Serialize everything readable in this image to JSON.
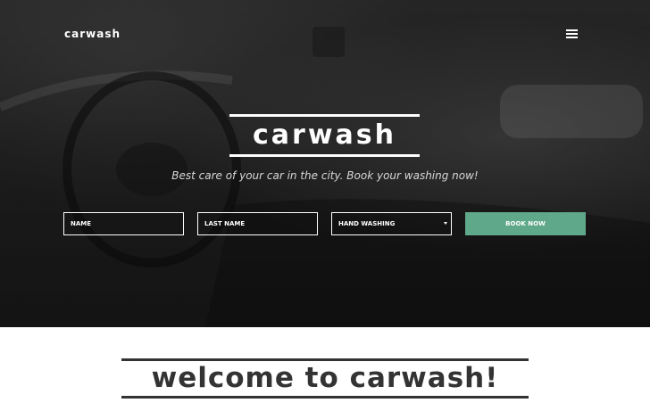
{
  "header": {
    "logo": "carwash",
    "menu_icon": "hamburger-menu-icon"
  },
  "hero": {
    "title": "carwash",
    "tagline": "Best care of your car in the city. Book your washing now!"
  },
  "booking_form": {
    "name_placeholder": "NAME",
    "last_name_placeholder": "LAST NAME",
    "service_selected": "HAND WASHING",
    "book_button": "BOOK NOW"
  },
  "welcome": {
    "title": "welcome to carwash!"
  },
  "colors": {
    "accent": "#5fa889",
    "dark_text": "#333333"
  }
}
